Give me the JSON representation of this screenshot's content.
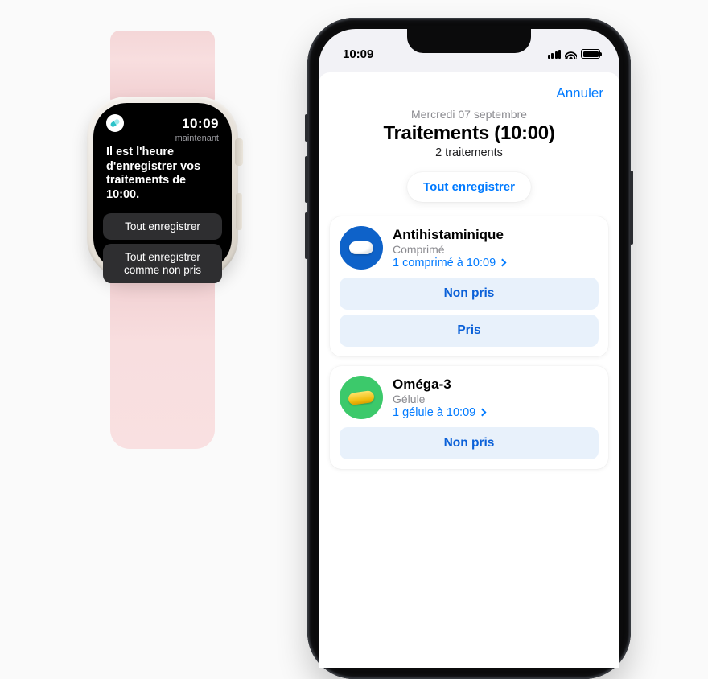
{
  "watch": {
    "time": "10:09",
    "subtitle": "maintenant",
    "headline": "Il est l'heure d'enregistrer vos traitements de 10:00.",
    "action_log_all": "Tout enregistrer",
    "action_log_skipped": "Tout enregistrer comme non pris"
  },
  "phone": {
    "status_time": "10:09",
    "cancel": "Annuler",
    "date": "Mercredi 07 septembre",
    "title": "Traitements (10:00)",
    "subtitle": "2 traitements",
    "log_all": "Tout enregistrer",
    "btn_skipped": "Non pris",
    "btn_taken": "Pris",
    "meds": [
      {
        "name": "Antihistaminique",
        "form": "Comprimé",
        "dose": "1 comprimé à 10:09",
        "icon": "tablet",
        "color": "blue"
      },
      {
        "name": "Oméga-3",
        "form": "Gélule",
        "dose": "1 gélule à 10:09",
        "icon": "capsule",
        "color": "green"
      }
    ]
  }
}
